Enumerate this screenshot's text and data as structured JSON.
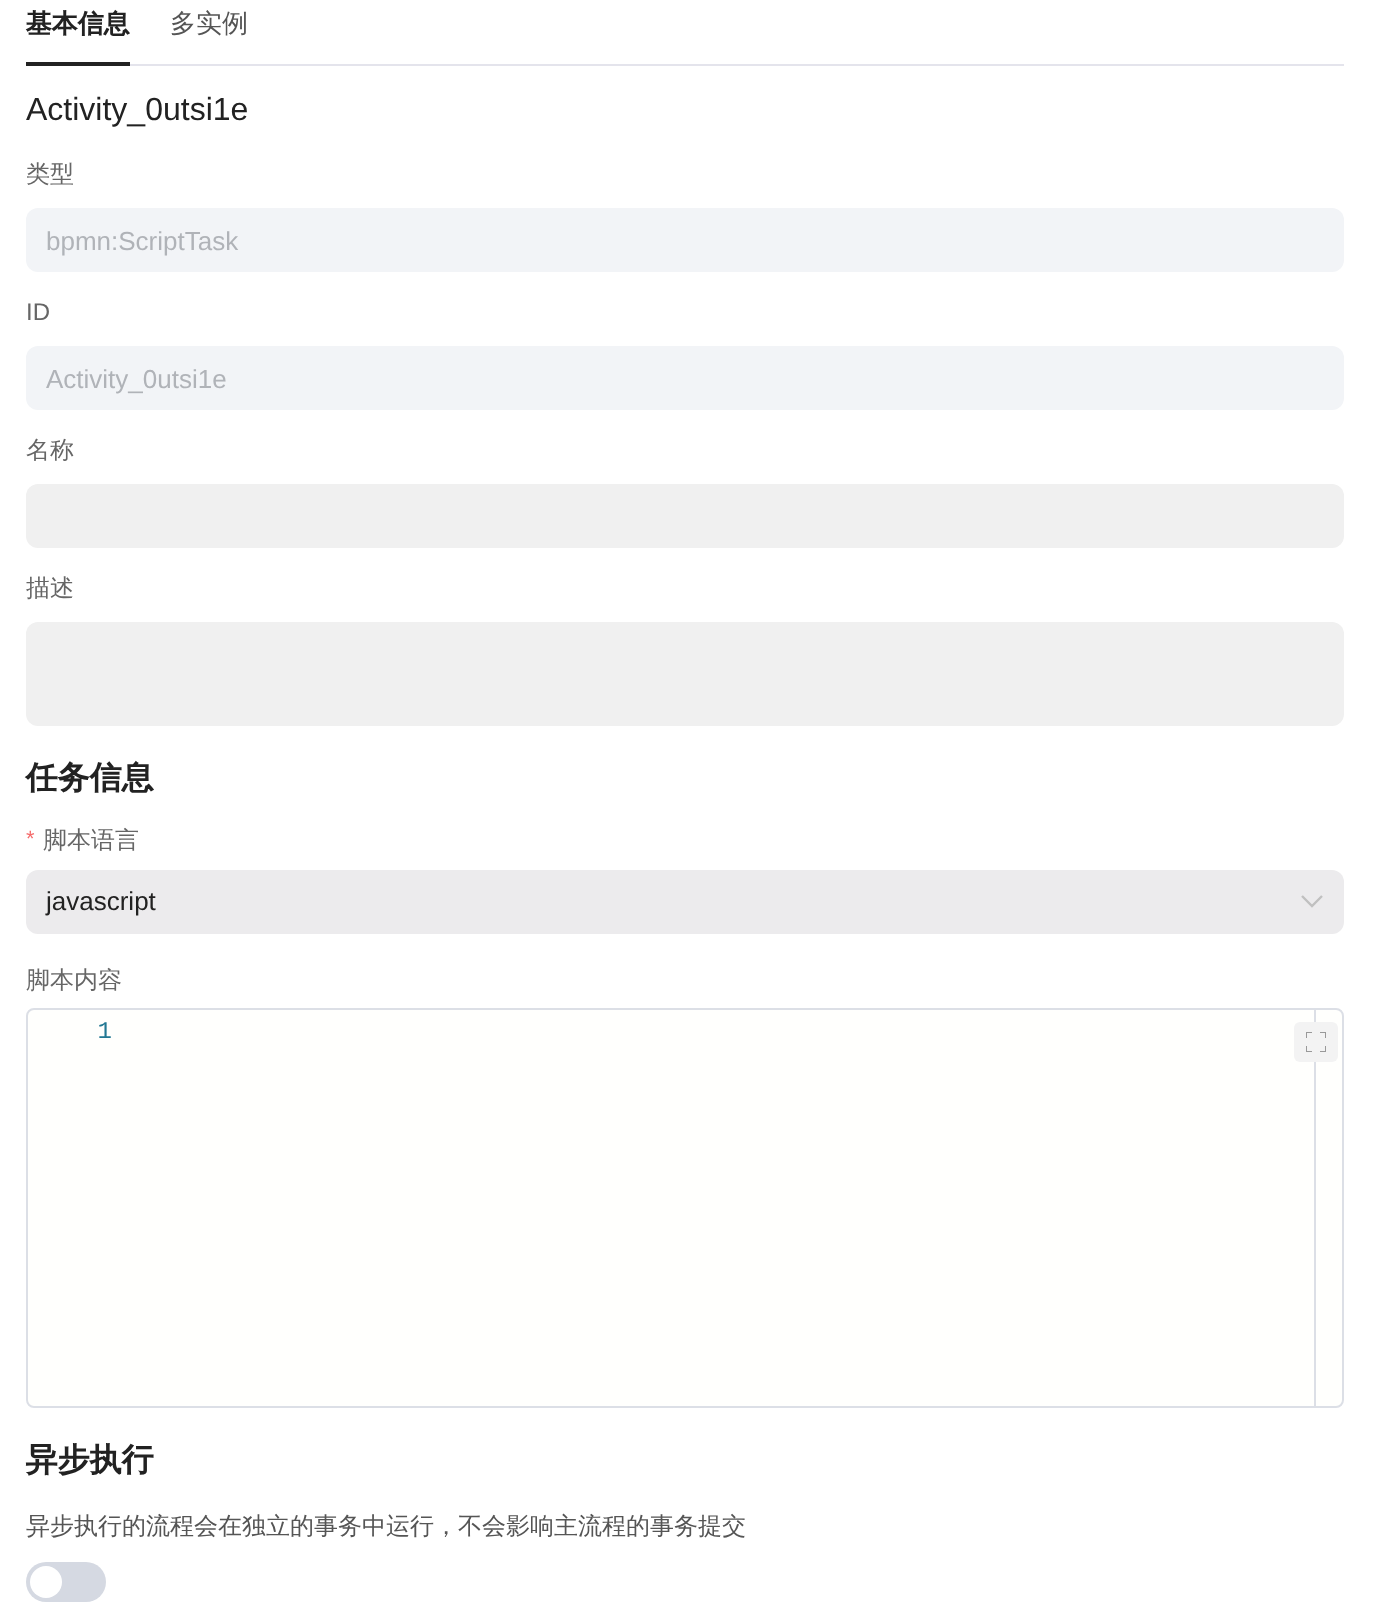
{
  "tabs": [
    {
      "label": "基本信息",
      "selected": true
    },
    {
      "label": "多实例",
      "selected": false
    }
  ],
  "element_title": "Activity_0utsi1e",
  "basic_fields": [
    {
      "label": "类型",
      "kind": "input",
      "value": "bpmn:ScriptTask",
      "disabled": true
    },
    {
      "label": "ID",
      "kind": "input",
      "value": "Activity_0utsi1e",
      "disabled": true
    },
    {
      "label": "名称",
      "kind": "input"
    },
    {
      "label": "描述",
      "kind": "textarea"
    }
  ],
  "task_section": {
    "title": "任务信息",
    "script_language": {
      "label": "脚本语言",
      "required_mark": "*",
      "value": "javascript"
    },
    "script_content": {
      "label": "脚本内容",
      "line_numbers": [
        "1"
      ]
    }
  },
  "async_section": {
    "title": "异步执行",
    "description": "异步执行的流程会在独立的事务中运行，不会影响主流程的事务提交",
    "on": false
  }
}
